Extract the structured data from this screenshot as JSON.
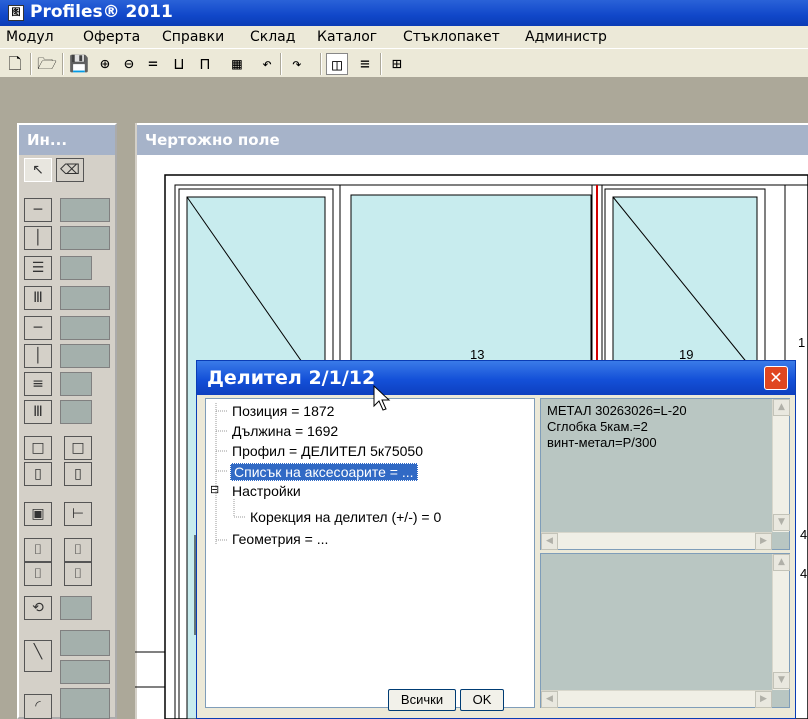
{
  "app": {
    "title": "Profiles® 2011",
    "icon_text": "图"
  },
  "menu": [
    "Модул",
    "Оферта",
    "Справки",
    "Склад",
    "Каталог",
    "Стъклопакет",
    "Администр"
  ],
  "toolbar": {
    "icons": [
      "new-icon",
      "open-icon",
      "save-icon",
      "zoom-in-icon",
      "zoom-out-icon",
      "equal-icon",
      "profile-l-icon",
      "profile-t-icon",
      "grid-frame-icon",
      "undo-icon",
      "redo-icon",
      "two-pane-icon",
      "lines-icon",
      "table-icon"
    ],
    "glyphs": [
      "🗋",
      "🗁",
      "💾",
      "⊕",
      "⊖",
      "=",
      "⊔",
      "⊓",
      "▦",
      "↶",
      "↷",
      "◫",
      "≡",
      "⊞"
    ]
  },
  "palette": {
    "title": "Ин..."
  },
  "drawing": {
    "title": "Чертожно поле",
    "dims": [
      "13",
      "19",
      "1",
      "4",
      "4"
    ]
  },
  "dialog": {
    "title": "Делител  2/1/12",
    "close": "✕",
    "tree": [
      {
        "label": "Позиция = 1872",
        "indent": 0,
        "selected": false
      },
      {
        "label": "Дължина = 1692",
        "indent": 0,
        "selected": false
      },
      {
        "label": "Профил = ДЕЛИТЕЛ 5к75050",
        "indent": 0,
        "selected": false
      },
      {
        "label": "Списък на аксесоарите = ...",
        "indent": 0,
        "selected": true
      },
      {
        "label": "Настройки",
        "indent": 0,
        "selected": false,
        "expander": "⊟"
      },
      {
        "label": "Корекция на делител (+/-)   = 0",
        "indent": 1,
        "selected": false
      },
      {
        "label": "Геометрия = ...",
        "indent": 0,
        "selected": false
      }
    ],
    "memo_lines": [
      "МЕТАЛ 30263026=L-20",
      "Сглобка 5кам.=2",
      "винт-метал=P/300"
    ],
    "buttons": {
      "all": "Всички",
      "ok": "OK"
    }
  }
}
